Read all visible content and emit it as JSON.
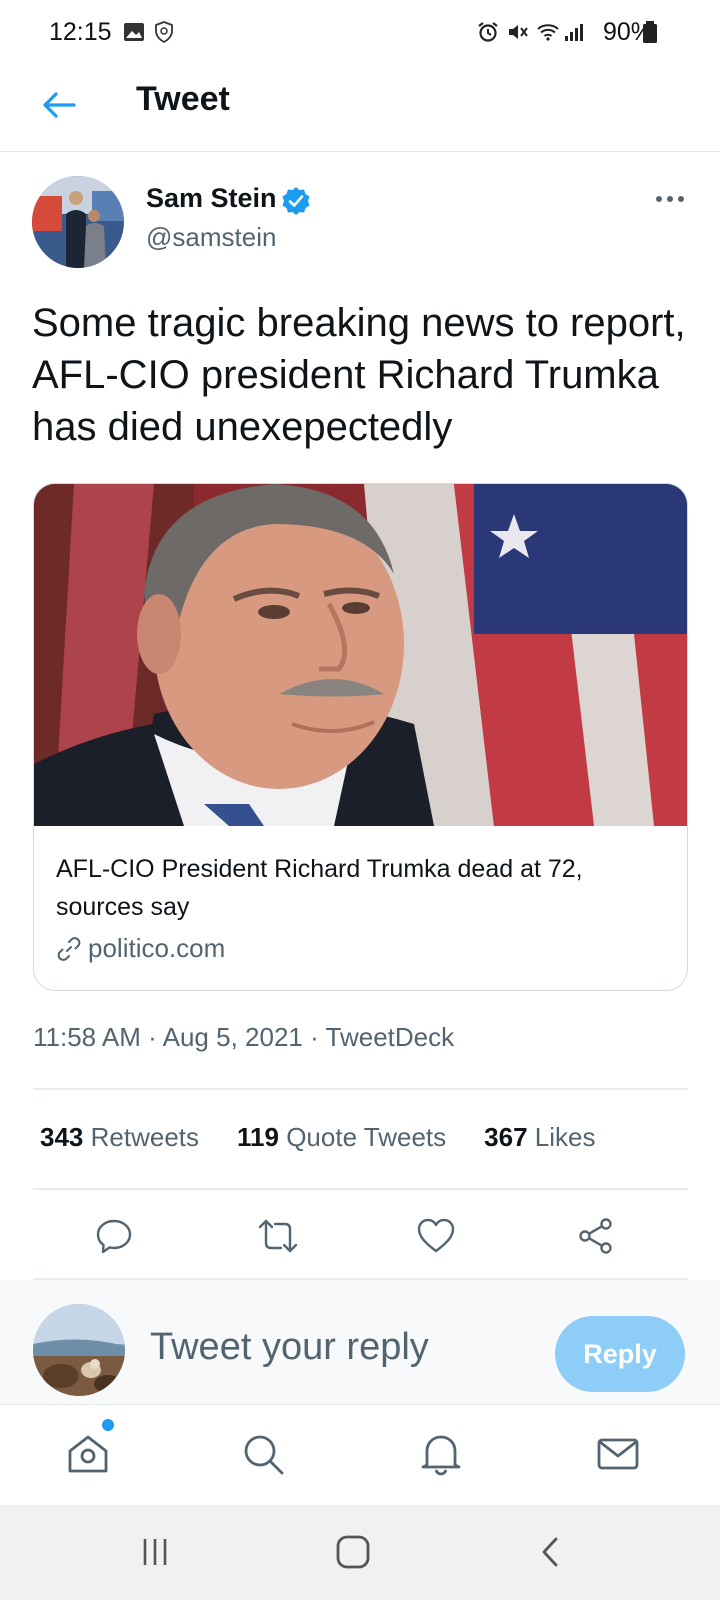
{
  "status_bar": {
    "time": "12:15",
    "battery": "90%"
  },
  "header": {
    "title": "Tweet"
  },
  "tweet": {
    "author_name": "Sam Stein",
    "author_handle": "@samstein",
    "text": "Some tragic breaking news to report, AFL-CIO president Richard Trumka has died unexepectedly",
    "card": {
      "title": "AFL-CIO President Richard Trumka dead at 72, sources say",
      "domain": "politico.com"
    },
    "time": "11:58 AM",
    "date": "Aug 5, 2021",
    "source": "TweetDeck",
    "stats": [
      {
        "count": "343",
        "label": "Retweets"
      },
      {
        "count": "119",
        "label": "Quote Tweets"
      },
      {
        "count": "367",
        "label": "Likes"
      }
    ]
  },
  "actions": [
    "reply-icon",
    "retweet-icon",
    "like-icon",
    "share-icon"
  ],
  "reply": {
    "placeholder": "Tweet your reply",
    "button_label": "Reply"
  },
  "bottom_nav": [
    "home-icon",
    "search-icon",
    "notifications-icon",
    "messages-icon"
  ],
  "colors": {
    "accent": "#1d9bf0",
    "reply_button_disabled": "#8ecdf8",
    "secondary_text": "#536471"
  }
}
